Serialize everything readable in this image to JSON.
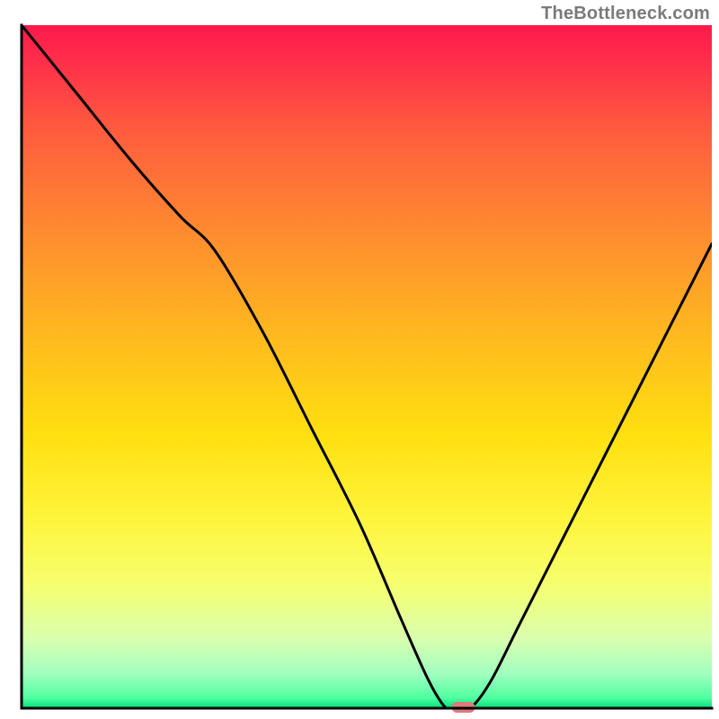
{
  "attribution": "TheBottleneck.com",
  "chart_data": {
    "type": "line",
    "title": "",
    "xlabel": "",
    "ylabel": "",
    "xlim": [
      0,
      100
    ],
    "ylim": [
      0,
      100
    ],
    "legend": false,
    "grid": false,
    "background_gradient": {
      "stops": [
        {
          "offset": 0.0,
          "color": "#ff1a4b"
        },
        {
          "offset": 0.05,
          "color": "#ff2d4a"
        },
        {
          "offset": 0.15,
          "color": "#ff5a3f"
        },
        {
          "offset": 0.3,
          "color": "#ff8a30"
        },
        {
          "offset": 0.45,
          "color": "#ffb81f"
        },
        {
          "offset": 0.6,
          "color": "#ffe010"
        },
        {
          "offset": 0.72,
          "color": "#fff43b"
        },
        {
          "offset": 0.82,
          "color": "#f6ff70"
        },
        {
          "offset": 0.9,
          "color": "#d8ffb0"
        },
        {
          "offset": 0.95,
          "color": "#a0ffc0"
        },
        {
          "offset": 0.985,
          "color": "#4fffa0"
        },
        {
          "offset": 1.0,
          "color": "#00e07a"
        }
      ]
    },
    "curve": {
      "x": [
        0,
        8,
        16,
        23,
        28,
        35,
        42,
        49,
        55,
        59,
        61.5,
        63,
        65,
        68,
        72,
        78,
        85,
        92,
        100
      ],
      "y": [
        100,
        90,
        80,
        72,
        67,
        55,
        41,
        27,
        13,
        4,
        0,
        0,
        0,
        4,
        12,
        24,
        38,
        52,
        68
      ]
    },
    "marker": {
      "x": 64,
      "y": 0,
      "color": "#e07a7a"
    },
    "axes_color": "#000000",
    "axes_width": 3,
    "curve_color": "#000000",
    "curve_width": 3
  }
}
